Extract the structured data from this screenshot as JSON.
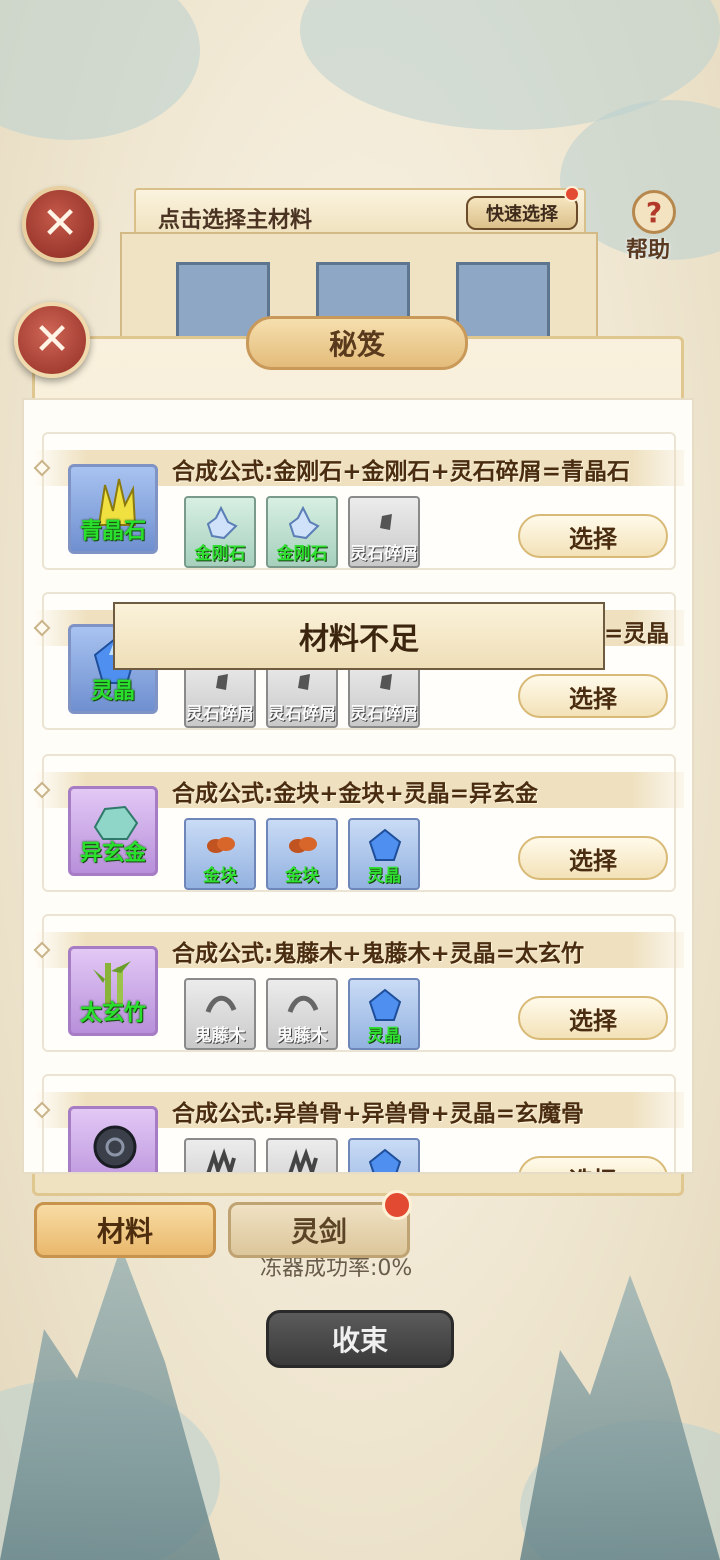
{
  "background": {
    "main_material_prompt": "点击选择主材料",
    "quick_select_label": "快速选择",
    "help_label": "帮助",
    "help_icon_glyph": "?",
    "success_rate_text": "冻器成功率:0%",
    "close_action_label": "收束"
  },
  "dialog": {
    "title": "秘笈",
    "close_glyph": "✕",
    "toast": "材料不足",
    "toast_trailing_text": "=灵晶"
  },
  "recipes": [
    {
      "formula": "合成公式:金刚石+金刚石+灵石碎屑=青晶石",
      "product": {
        "name": "青晶石",
        "icon": "yellow-crystal-icon"
      },
      "ingredients": [
        {
          "name": "金刚石",
          "icon": "diamond-crystal-icon",
          "available": true
        },
        {
          "name": "金刚石",
          "icon": "diamond-crystal-icon",
          "available": true
        },
        {
          "name": "灵石碎屑",
          "icon": "stone-shard-icon",
          "available": false
        }
      ],
      "select_label": "选择"
    },
    {
      "formula": "",
      "product": {
        "name": "灵晶",
        "icon": "blue-gem-icon"
      },
      "ingredients": [
        {
          "name": "灵石碎屑",
          "icon": "stone-shard-icon",
          "available": false
        },
        {
          "name": "灵石碎屑",
          "icon": "stone-shard-icon",
          "available": false
        },
        {
          "name": "灵石碎屑",
          "icon": "stone-shard-icon",
          "available": false
        }
      ],
      "select_label": "选择"
    },
    {
      "formula": "合成公式:金块+金块+灵晶=异玄金",
      "product": {
        "name": "异玄金",
        "icon": "jade-ingot-icon"
      },
      "ingredients": [
        {
          "name": "金块",
          "icon": "gold-nugget-icon",
          "available": true
        },
        {
          "name": "金块",
          "icon": "gold-nugget-icon",
          "available": true
        },
        {
          "name": "灵晶",
          "icon": "blue-gem-icon",
          "available": true
        }
      ],
      "select_label": "选择"
    },
    {
      "formula": "合成公式:鬼藤木+鬼藤木+灵晶=太玄竹",
      "product": {
        "name": "太玄竹",
        "icon": "bamboo-icon"
      },
      "ingredients": [
        {
          "name": "鬼藤木",
          "icon": "vine-wood-icon",
          "available": false
        },
        {
          "name": "鬼藤木",
          "icon": "vine-wood-icon",
          "available": false
        },
        {
          "name": "灵晶",
          "icon": "blue-gem-icon",
          "available": true
        }
      ],
      "select_label": "选择"
    },
    {
      "formula": "合成公式:异兽骨+异兽骨+灵晶=玄魔骨",
      "product": {
        "name": "",
        "icon": "dark-bone-icon"
      },
      "ingredients": [
        {
          "name": "",
          "icon": "beast-bone-icon",
          "available": false
        },
        {
          "name": "",
          "icon": "beast-bone-icon",
          "available": false
        },
        {
          "name": "",
          "icon": "blue-gem-icon",
          "available": true
        }
      ],
      "select_label": "选择"
    }
  ],
  "tabs": [
    {
      "label": "材料",
      "active": true
    },
    {
      "label": "灵剑",
      "active": false
    }
  ],
  "colors": {
    "accent_gold": "#e9b86c",
    "close_red": "#932e25",
    "available_label_green": "#29e02c",
    "notification_red": "#e24a32"
  }
}
